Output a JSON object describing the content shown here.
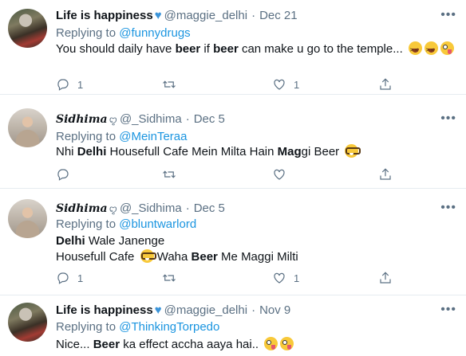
{
  "tweets": [
    {
      "name": "Life is happiness",
      "handle": "@maggie_delhi",
      "date": "Dec 21",
      "replying_prefix": "Replying to",
      "replying_to": "@funnydrugs",
      "text_parts": [
        "You should daily have ",
        "beer",
        " if ",
        "beer",
        " can make u go to the temple..."
      ],
      "emojis": [
        "laughing-face",
        "laughing-face",
        "winking-face-tongue"
      ],
      "reply_count": "1",
      "like_count": "1"
    },
    {
      "name": "Sidhima",
      "name_symbol": "ꨄ︎",
      "handle": "@_Sidhima",
      "date": "Dec 5",
      "replying_prefix": "Replying to",
      "replying_to": "@MeinTeraa",
      "text_parts": [
        "Nhi ",
        "Delhi",
        " Housefull Cafe Mein Milta Hain ",
        "Mag",
        "gi Beer"
      ],
      "emojis": [
        "nerd-face"
      ]
    },
    {
      "name": "Sidhima",
      "name_symbol": "ꨄ︎",
      "handle": "@_Sidhima",
      "date": "Dec 5",
      "replying_prefix": "Replying to",
      "replying_to": "@bluntwarlord",
      "line1_parts": [
        "Delhi",
        " Wale Janenge"
      ],
      "line2_parts": [
        "Housefull Cafe ",
        " Waha ",
        "Beer",
        " Me Maggi Milti"
      ],
      "emojis": [
        "nerd-face"
      ],
      "reply_count": "1",
      "like_count": "1"
    },
    {
      "name": "Life is happiness",
      "handle": "@maggie_delhi",
      "date": "Nov 9",
      "replying_prefix": "Replying to",
      "replying_to": "@ThinkingTorpedo",
      "text_parts": [
        "Nice... ",
        "Beer",
        " ka effect accha aaya hai.."
      ],
      "emojis": [
        "winking-face-tongue",
        "winking-face-tongue"
      ]
    }
  ],
  "more_glyph": "•••",
  "icons": {
    "reply": "reply-icon",
    "retweet": "retweet-icon",
    "like": "heart-icon",
    "share": "share-icon",
    "verified": "blue-heart-icon"
  },
  "colors": {
    "link": "#1b95e0",
    "secondary": "#5b7083",
    "primary_text": "#0f1419",
    "divider": "#e6ecf0"
  }
}
